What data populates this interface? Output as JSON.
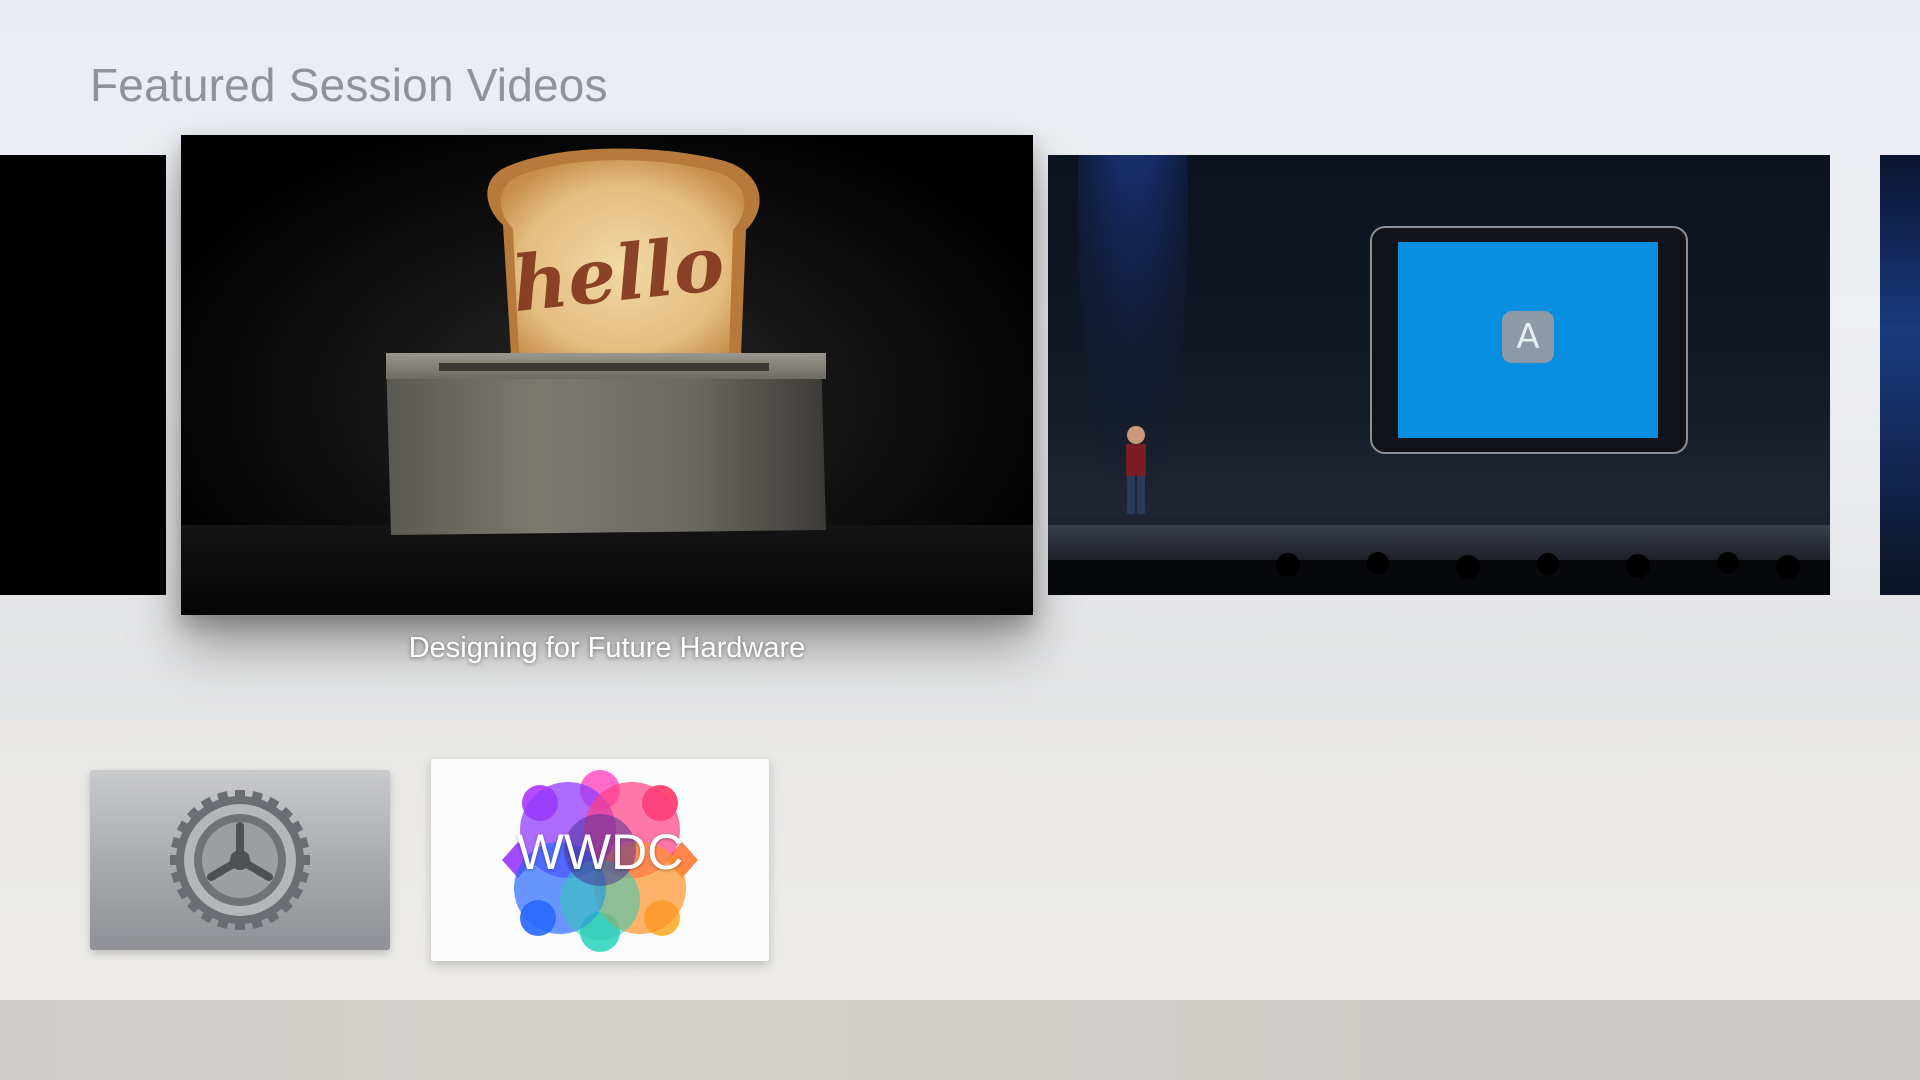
{
  "section": {
    "title": "Featured Session Videos"
  },
  "carousel": {
    "items": [
      {
        "name": "previous-video",
        "caption": ""
      },
      {
        "name": "focused-video",
        "caption": "Designing for Future Hardware",
        "image_text": "hello"
      },
      {
        "name": "next-video",
        "caption": ""
      },
      {
        "name": "far-next-video",
        "caption": ""
      }
    ]
  },
  "dock": {
    "apps": [
      {
        "name": "Settings",
        "icon": "gear-icon"
      },
      {
        "name": "WWDC",
        "label": "WWDC",
        "icon": "wwdc-logo"
      }
    ]
  },
  "colors": {
    "title_gray": "#8e939a",
    "screen_blue": "#0a8fe0",
    "background": "#eceef1"
  }
}
